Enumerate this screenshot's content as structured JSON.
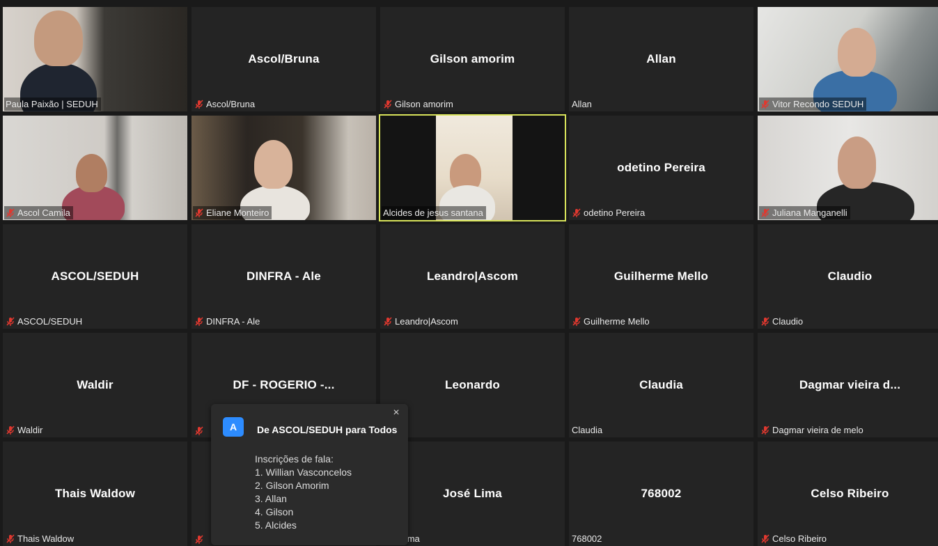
{
  "participants": [
    {
      "name": "Paula Paixão | SEDUH",
      "center": "",
      "muted": false,
      "video": "paula"
    },
    {
      "name": "Ascol/Bruna",
      "center": "Ascol/Bruna",
      "muted": true,
      "video": ""
    },
    {
      "name": "Gilson amorim",
      "center": "Gilson amorim",
      "muted": true,
      "video": ""
    },
    {
      "name": "Allan",
      "center": "Allan",
      "muted": false,
      "video": ""
    },
    {
      "name": "Vitor Recondo SEDUH",
      "center": "",
      "muted": true,
      "video": "vitor"
    },
    {
      "name": "Ascol Camila",
      "center": "",
      "muted": true,
      "video": "camila"
    },
    {
      "name": "Eliane Monteiro",
      "center": "",
      "muted": true,
      "video": "eliane"
    },
    {
      "name": "Alcides de jesus santana",
      "center": "",
      "muted": false,
      "video": "alcides"
    },
    {
      "name": "odetino Pereira",
      "center": "odetino Pereira",
      "muted": true,
      "video": ""
    },
    {
      "name": "Juliana Manganelli",
      "center": "",
      "muted": true,
      "video": "juliana"
    },
    {
      "name": "ASCOL/SEDUH",
      "center": "ASCOL/SEDUH",
      "muted": true,
      "video": ""
    },
    {
      "name": "DINFRA - Ale",
      "center": "DINFRA - Ale",
      "muted": true,
      "video": ""
    },
    {
      "name": "Leandro|Ascom",
      "center": "Leandro|Ascom",
      "muted": true,
      "video": ""
    },
    {
      "name": "Guilherme Mello",
      "center": "Guilherme Mello",
      "muted": true,
      "video": ""
    },
    {
      "name": "Claudio",
      "center": "Claudio",
      "muted": true,
      "video": ""
    },
    {
      "name": "Waldir",
      "center": "Waldir",
      "muted": true,
      "video": ""
    },
    {
      "name": "",
      "center": "DF - ROGERIO -...",
      "muted": true,
      "video": ""
    },
    {
      "name": "ardo",
      "center": "Leonardo",
      "muted": false,
      "video": ""
    },
    {
      "name": "Claudia",
      "center": "Claudia",
      "muted": false,
      "video": ""
    },
    {
      "name": "Dagmar vieira de melo",
      "center": "Dagmar vieira d...",
      "muted": true,
      "video": ""
    },
    {
      "name": "Thais Waldow",
      "center": "Thais Waldow",
      "muted": true,
      "video": ""
    },
    {
      "name": "",
      "center": "",
      "muted": true,
      "video": ""
    },
    {
      "name": "osé Lima",
      "center": "José Lima",
      "muted": false,
      "video": ""
    },
    {
      "name": "768002",
      "center": "768002",
      "muted": false,
      "video": ""
    },
    {
      "name": "Celso Ribeiro",
      "center": "Celso Ribeiro",
      "muted": true,
      "video": ""
    }
  ],
  "active_speaker_index": 7,
  "chat_popup": {
    "avatar_letter": "A",
    "from": "De ASCOL/SEDUH para Todos",
    "close_icon": "×",
    "lines": [
      "Inscrições de fala:",
      "1. Willian Vasconcelos",
      "2. Gilson Amorim",
      "3. Allan",
      "4. Gilson",
      "5. Alcides"
    ]
  },
  "colors": {
    "active_border": "#d8e35a",
    "mute_icon": "#e0382f",
    "avatar": "#2d8cff"
  },
  "icons": {
    "mute": "muted-microphone-icon"
  }
}
